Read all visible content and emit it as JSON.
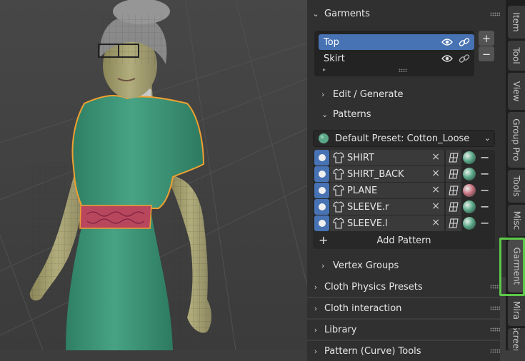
{
  "garments_panel": {
    "title": "Garments",
    "list": [
      {
        "name": "Top",
        "selected": true
      },
      {
        "name": "Skirt",
        "selected": false
      }
    ],
    "add_label": "+",
    "remove_label": "−",
    "edit_generate": "Edit / Generate",
    "patterns": "Patterns",
    "preset": "Default Preset: Cotton_Loose",
    "pattern_rows": [
      {
        "name": "SHIRT",
        "material_color": "#5aa888"
      },
      {
        "name": "SHIRT_BACK",
        "material_color": "#5aa888"
      },
      {
        "name": "PLANE",
        "material_color": "#c9707e"
      },
      {
        "name": "SLEEVE.r",
        "material_color": "#5aa888"
      },
      {
        "name": "SLEEVE.l",
        "material_color": "#5aa888"
      }
    ],
    "row_remove": "×",
    "row_minus": "−",
    "add_pattern": "Add Pattern",
    "add_pattern_plus": "+",
    "vertex_groups": "Vertex Groups"
  },
  "collapsed_panels": [
    "Cloth Physics Presets",
    "Cloth interaction",
    "Library",
    "Pattern (Curve) Tools"
  ],
  "tabs": [
    "Item",
    "Tool",
    "View",
    "Group Pro",
    "Tools",
    "Misc",
    "Garment",
    "Mira",
    "Screen"
  ],
  "active_tab": "Garment",
  "colors": {
    "accent": "#4772b3",
    "panel_bg": "#303030",
    "selection_outline": "#f0a030",
    "garment_green": "#3f9a7a",
    "belt": "#b8475e",
    "tab_highlight": "#5ec94a"
  }
}
